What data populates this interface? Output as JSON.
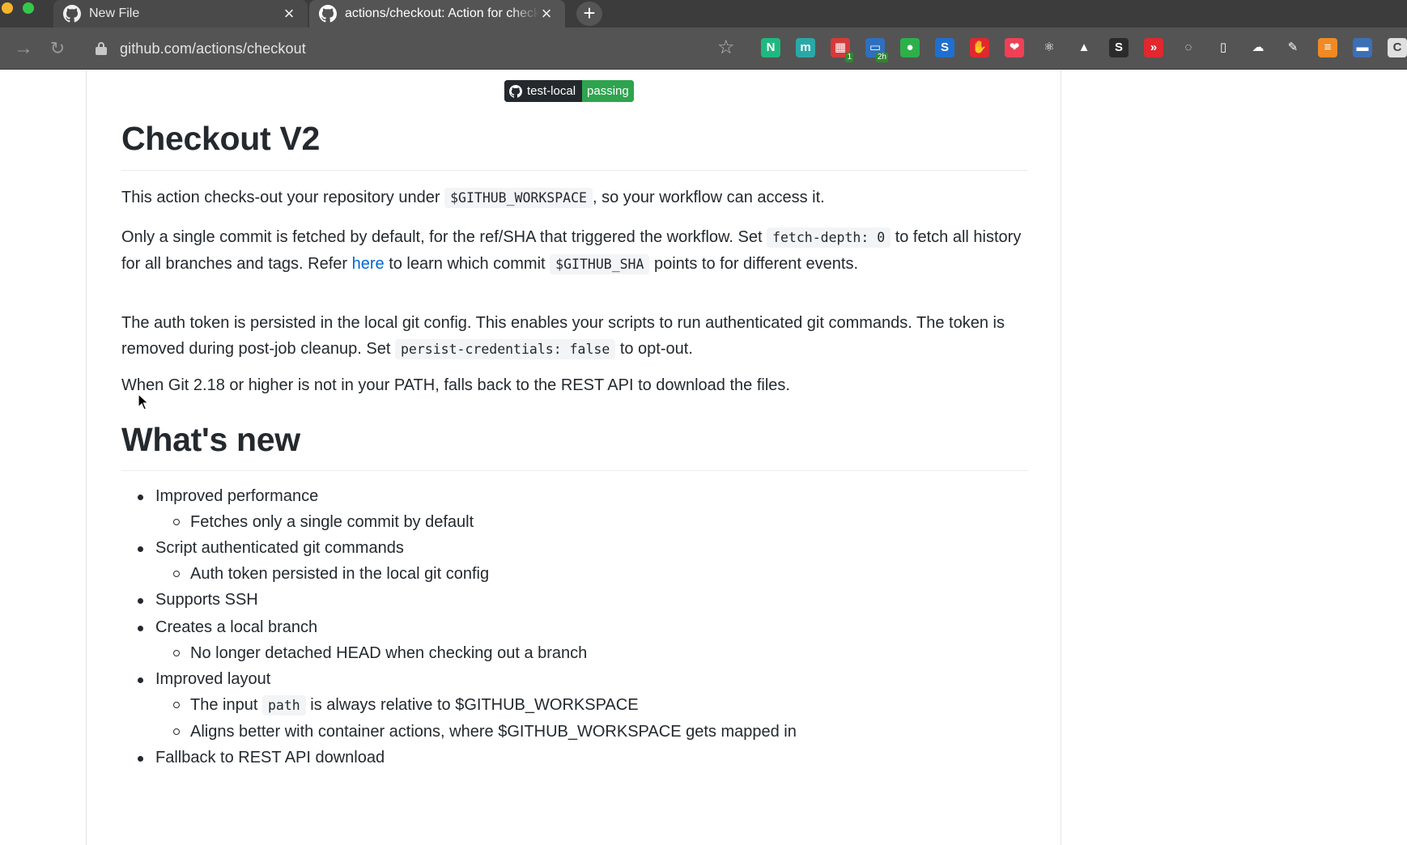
{
  "browser": {
    "tabs": [
      {
        "title": "New File",
        "close": "×"
      },
      {
        "title": "actions/checkout: Action for checking out a repo",
        "close": "×"
      }
    ],
    "new_tab": "+",
    "url": "github.com/actions/checkout",
    "extensions": [
      {
        "icon": "n-icon",
        "label": "N",
        "color": "#1fb881"
      },
      {
        "icon": "m-icon",
        "label": "m",
        "color": "#2aa8a8"
      },
      {
        "icon": "calendar-icon",
        "label": "▦",
        "color": "#d63a3a",
        "badge": "1"
      },
      {
        "icon": "window-icon",
        "label": "▭",
        "color": "#2f6fbf",
        "badge": "2h"
      },
      {
        "icon": "evernote-icon",
        "label": "●",
        "color": "#2db04a"
      },
      {
        "icon": "s-icon",
        "label": "S",
        "color": "#1f6fd1"
      },
      {
        "icon": "stop-icon",
        "label": "✋",
        "color": "#e0282e"
      },
      {
        "icon": "pocket-icon",
        "label": "❤",
        "color": "#ef4056"
      },
      {
        "icon": "atom-icon",
        "label": "⚛",
        "color": "#545454"
      },
      {
        "icon": "drive-icon",
        "label": "▲",
        "color": "#545454"
      },
      {
        "icon": "s-dark-icon",
        "label": "S",
        "color": "#2b2b2b"
      },
      {
        "icon": "forward-icon",
        "label": "»",
        "color": "#e0282e"
      },
      {
        "icon": "bulb-icon",
        "label": "◌",
        "color": "#545454"
      },
      {
        "icon": "bookmark-icon",
        "label": "▯",
        "color": "#545454"
      },
      {
        "icon": "cloud-icon",
        "label": "☁",
        "color": "#545454"
      },
      {
        "icon": "eyedropper-icon",
        "label": "✎",
        "color": "#545454"
      },
      {
        "icon": "orange-icon",
        "label": "≡",
        "color": "#f08a24"
      },
      {
        "icon": "blue-icon",
        "label": "▬",
        "color": "#3b6fb6"
      },
      {
        "icon": "c-icon",
        "label": "C",
        "color": "#e0e0e0"
      }
    ]
  },
  "badge": {
    "left": "test-local",
    "right": "passing"
  },
  "heading1": "Checkout V2",
  "para1": {
    "a": "This action checks-out your repository under ",
    "code": "$GITHUB_WORKSPACE",
    "b": ", so your workflow can access it."
  },
  "para2": {
    "a": "Only a single commit is fetched by default, for the ref/SHA that triggered the workflow. Set ",
    "code1": "fetch-depth: 0",
    "b": " to fetch all history for all branches and tags. Refer ",
    "link": "here",
    "c": " to learn which commit ",
    "code2": "$GITHUB_SHA",
    "d": " points to for different events."
  },
  "para3": {
    "a": "The auth token is persisted in the local git config. This enables your scripts to run authenticated git commands. The token is removed during post-job cleanup. Set ",
    "code": "persist-credentials: false",
    "b": " to opt-out."
  },
  "para4": "When Git 2.18 or higher is not in your PATH, falls back to the REST API to download the files.",
  "heading2": "What's new",
  "whats_new": {
    "item1": "Improved performance",
    "item1_sub1": "Fetches only a single commit by default",
    "item2": "Script authenticated git commands",
    "item2_sub1": "Auth token persisted in the local git config",
    "item3": "Supports SSH",
    "item4": "Creates a local branch",
    "item4_sub1": "No longer detached HEAD when checking out a branch",
    "item5": "Improved layout",
    "item5_sub1_a": "The input ",
    "item5_sub1_code": "path",
    "item5_sub1_b": " is always relative to $GITHUB_WORKSPACE",
    "item5_sub2": "Aligns better with container actions, where $GITHUB_WORKSPACE gets mapped in",
    "item6": "Fallback to REST API download"
  }
}
